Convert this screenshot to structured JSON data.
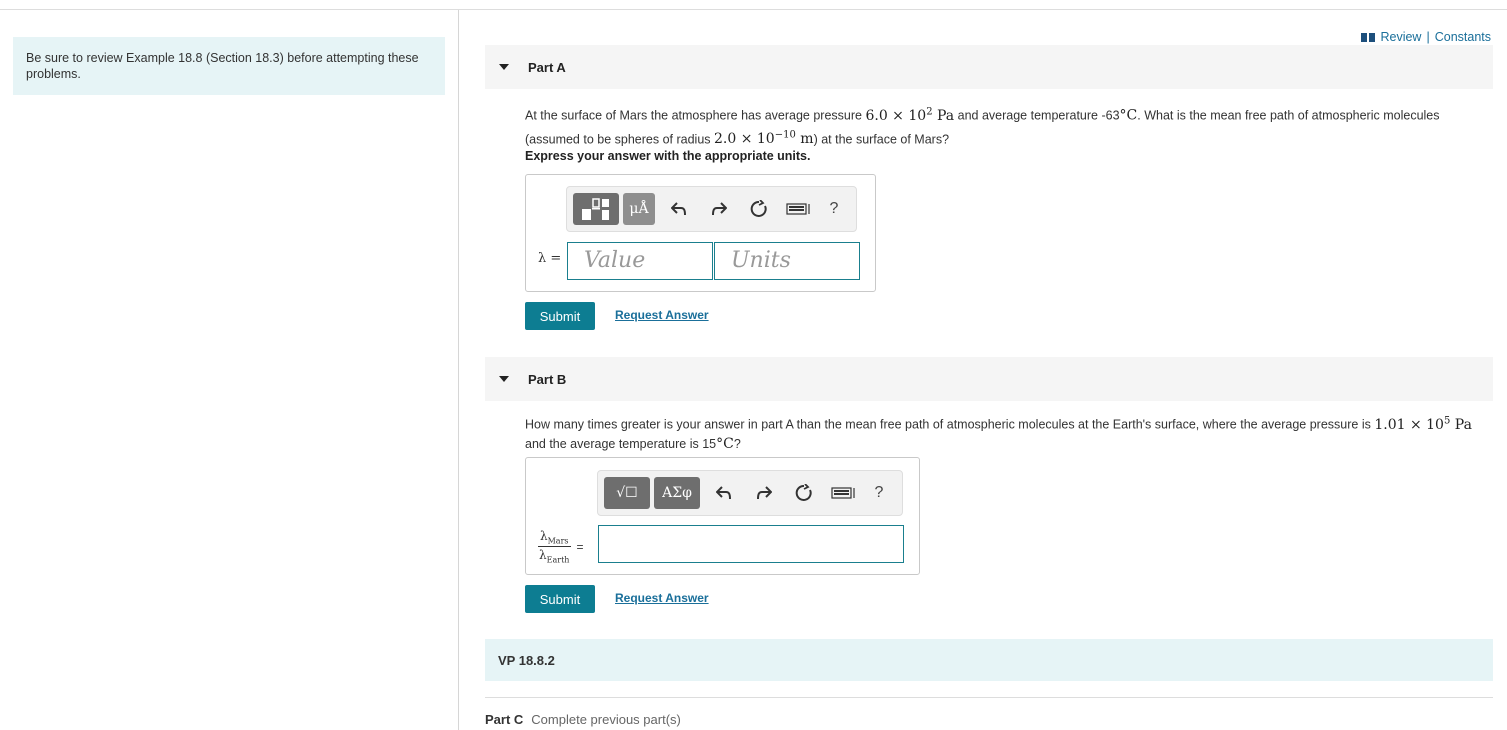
{
  "sidebar": {
    "note": "Be sure to review Example 18.8 (Section 18.3) before attempting these problems."
  },
  "header_links": {
    "review": "Review",
    "separator": "|",
    "constants": "Constants",
    "icon": "book-icon"
  },
  "part_a": {
    "label": "Part A",
    "question_pre": "At the surface of Mars the atmosphere has average pressure ",
    "pressure_value": "6.0 × 10",
    "pressure_exp": "2",
    "pressure_unit": " Pa",
    "question_mid": " and average temperature -63",
    "temp_unit": "°C",
    "question_mid2": ". What is the mean free path of atmospheric molecules (assumed to be spheres of radius ",
    "radius_value": "2.0 × 10",
    "radius_exp": "−10",
    "radius_unit": " m",
    "question_post": ") at the surface of Mars?",
    "instruction": "Express your answer with the appropriate units.",
    "lhs": "λ =",
    "value_placeholder": "Value",
    "units_placeholder": "Units",
    "toolbar": {
      "btn1_icon": "templates-icon",
      "btn2_label": "μÅ",
      "undo_icon": "undo-icon",
      "redo_icon": "redo-icon",
      "reset_icon": "reset-icon",
      "keyboard_icon": "keyboard-icon",
      "help": "?"
    },
    "submit": "Submit",
    "request_answer": "Request Answer"
  },
  "part_b": {
    "label": "Part B",
    "question_pre": "How many times greater is your answer in part A than the mean free path of atmospheric molecules at the Earth's surface, where the average pressure is ",
    "pressure_value": "1.01 × 10",
    "pressure_exp": "5",
    "pressure_unit": " Pa",
    "question_mid": " and the average temperature is 15",
    "temp_unit": "°C",
    "question_post": "?",
    "frac_num": "λ",
    "frac_num_sub": "Mars",
    "frac_den": "λ",
    "frac_den_sub": "Earth",
    "equals": "=",
    "toolbar": {
      "btn1_label": "√☐",
      "btn2_label": "ΑΣφ",
      "undo_icon": "undo-icon",
      "redo_icon": "redo-icon",
      "reset_icon": "reset-icon",
      "keyboard_icon": "keyboard-icon",
      "help": "?"
    },
    "submit": "Submit",
    "request_answer": "Request Answer"
  },
  "vp": {
    "label": "VP 18.8.2"
  },
  "part_c": {
    "label": "Part C",
    "note": "Complete previous part(s)"
  }
}
